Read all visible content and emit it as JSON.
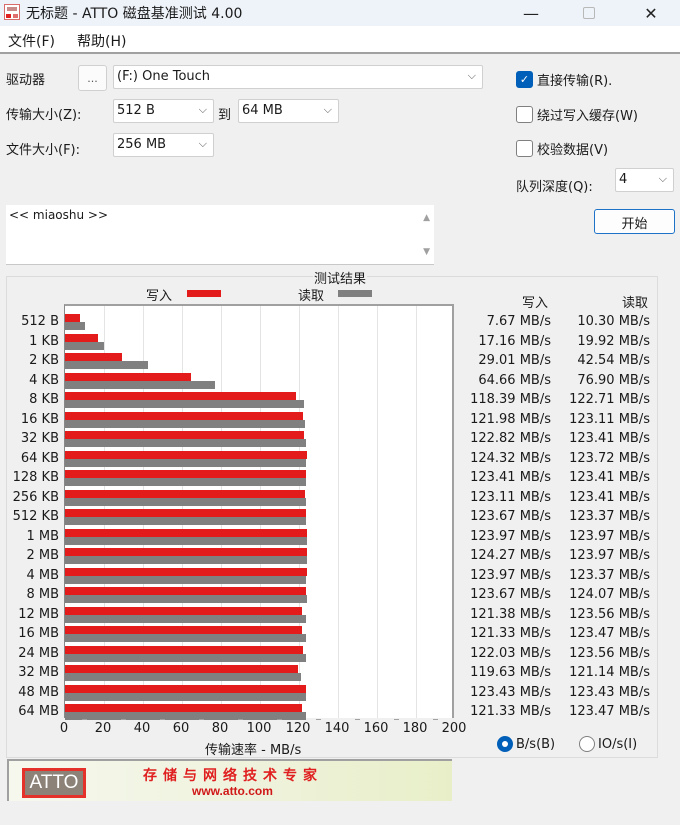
{
  "window": {
    "title": "无标题 - ATTO 磁盘基准测试 4.00",
    "minimize": "—",
    "close": "✕"
  },
  "menu": [
    {
      "label": "文件(F)"
    },
    {
      "label": "帮助(H)"
    }
  ],
  "settings": {
    "drive_label": "驱动器",
    "browse_label": "...",
    "drive_value": "(F:) One Touch",
    "transfer_size_label": "传输大小(Z):",
    "transfer_from": "512 B",
    "to_label": "到",
    "transfer_to": "64 MB",
    "file_size_label": "文件大小(F):",
    "file_size": "256 MB",
    "chevron": "⌵"
  },
  "options": {
    "direct_io": {
      "label": "直接传输(R).",
      "checked": true
    },
    "bypass_write_cache": {
      "label": "绕过写入缓存(W)",
      "checked": false
    },
    "verify_data": {
      "label": "校验数据(V)",
      "checked": false
    },
    "queue_depth_label": "队列深度(Q):",
    "queue_depth": "4",
    "start_label": "开始"
  },
  "description": {
    "text": "<< miaoshu >>"
  },
  "results": {
    "title": "测试结果",
    "legend_write": "写入",
    "legend_read": "读取",
    "col_write": "写入",
    "col_read": "读取",
    "write_values": [
      "7.67 MB/s",
      "17.16 MB/s",
      "29.01 MB/s",
      "64.66 MB/s",
      "118.39 MB/s",
      "121.98 MB/s",
      "122.82 MB/s",
      "124.32 MB/s",
      "123.41 MB/s",
      "123.11 MB/s",
      "123.67 MB/s",
      "123.97 MB/s",
      "124.27 MB/s",
      "123.97 MB/s",
      "123.67 MB/s",
      "121.38 MB/s",
      "121.33 MB/s",
      "122.03 MB/s",
      "119.63 MB/s",
      "123.43 MB/s",
      "121.33 MB/s"
    ],
    "read_values": [
      "10.30 MB/s",
      "19.92 MB/s",
      "42.54 MB/s",
      "76.90 MB/s",
      "122.71 MB/s",
      "123.11 MB/s",
      "123.41 MB/s",
      "123.72 MB/s",
      "123.41 MB/s",
      "123.41 MB/s",
      "123.37 MB/s",
      "123.97 MB/s",
      "123.97 MB/s",
      "123.37 MB/s",
      "124.07 MB/s",
      "123.56 MB/s",
      "123.47 MB/s",
      "123.56 MB/s",
      "121.14 MB/s",
      "123.43 MB/s",
      "123.47 MB/s"
    ],
    "units": {
      "bps": {
        "label": "B/s(B)",
        "selected": true
      },
      "iops": {
        "label": "IO/s(I)",
        "selected": false
      }
    }
  },
  "colors": {
    "write": "#e41b1b",
    "read": "#808080",
    "accent": "#005fb8"
  },
  "banner": {
    "logo": "ATTO",
    "slogan": "存储与网络技术专家",
    "url": "www.atto.com"
  },
  "chart_data": {
    "type": "bar",
    "orientation": "horizontal",
    "title": "测试结果",
    "xlabel": "传输速率 - MB/s",
    "ylabel": "",
    "xlim": [
      0,
      200
    ],
    "xticks": [
      "0",
      "20",
      "40",
      "60",
      "80",
      "100",
      "120",
      "140",
      "160",
      "180",
      "200"
    ],
    "grid": true,
    "legend_position": "top",
    "categories": [
      "512 B",
      "1 KB",
      "2 KB",
      "4 KB",
      "8 KB",
      "16 KB",
      "32 KB",
      "64 KB",
      "128 KB",
      "256 KB",
      "512 KB",
      "1 MB",
      "2 MB",
      "4 MB",
      "8 MB",
      "12 MB",
      "16 MB",
      "24 MB",
      "32 MB",
      "48 MB",
      "64 MB"
    ],
    "series": [
      {
        "name": "写入",
        "values": [
          7.67,
          17.16,
          29.01,
          64.66,
          118.39,
          121.98,
          122.82,
          124.32,
          123.41,
          123.11,
          123.67,
          123.97,
          124.27,
          123.97,
          123.67,
          121.38,
          121.33,
          122.03,
          119.63,
          123.43,
          121.33
        ]
      },
      {
        "name": "读取",
        "values": [
          10.3,
          19.92,
          42.54,
          76.9,
          122.71,
          123.11,
          123.41,
          123.72,
          123.41,
          123.41,
          123.37,
          123.97,
          123.97,
          123.37,
          124.07,
          123.56,
          123.47,
          123.56,
          121.14,
          123.43,
          123.47
        ]
      }
    ]
  }
}
